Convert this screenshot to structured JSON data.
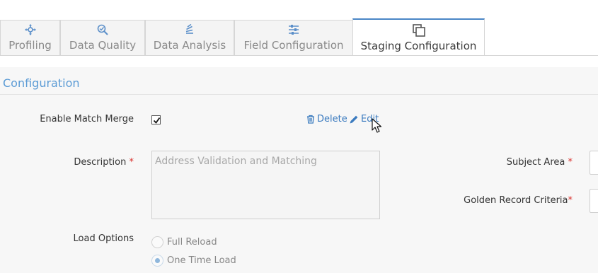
{
  "tabs": [
    {
      "label": "Profiling",
      "icon": "crosshair-arrows-icon",
      "active": false
    },
    {
      "label": "Data Quality",
      "icon": "magnify-check-icon",
      "active": false
    },
    {
      "label": "Data Analysis",
      "icon": "stacked-layers-icon",
      "active": false
    },
    {
      "label": "Field Configuration",
      "icon": "sliders-icon",
      "active": false
    },
    {
      "label": "Staging Configuration",
      "icon": "copy-windows-icon",
      "active": true
    }
  ],
  "section": {
    "title": "Configuration"
  },
  "form": {
    "enable_match_merge": {
      "label": "Enable Match Merge",
      "checked": true
    },
    "actions": {
      "delete_label": "Delete",
      "edit_label": "Edit"
    },
    "description": {
      "label": "Description",
      "required_mark": "*",
      "placeholder": "Address Validation and Matching"
    },
    "subject_area": {
      "label": "Subject Area",
      "required_mark": "*"
    },
    "golden_record_criteria": {
      "label": "Golden Record Criteria",
      "required_mark": "*"
    },
    "load_options": {
      "label": "Load Options",
      "options": [
        {
          "label": "Full Reload",
          "selected": false
        },
        {
          "label": "One Time Load",
          "selected": true
        }
      ]
    }
  },
  "colors": {
    "accent": "#4a86c6",
    "link": "#3b7bbf",
    "required": "#d9302c",
    "section_title": "#5b9bd5"
  }
}
